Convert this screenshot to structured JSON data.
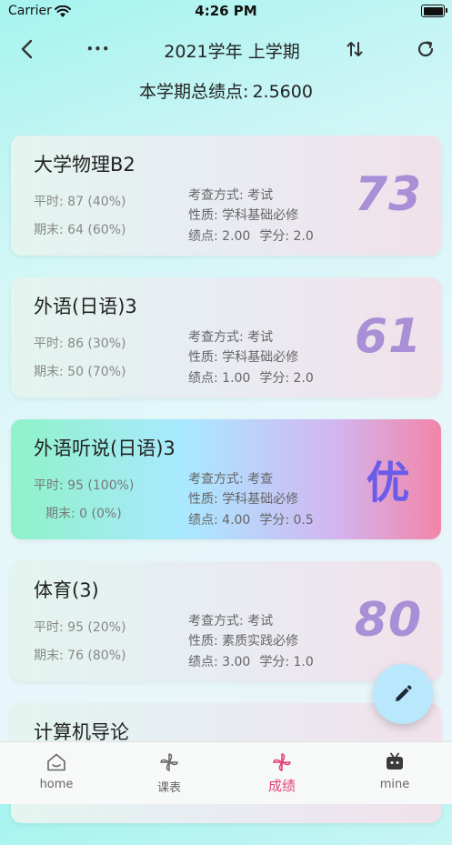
{
  "status": {
    "carrier": "Carrier",
    "time": "4:26 PM"
  },
  "nav": {
    "title": "2021学年  上学期",
    "more": "•••"
  },
  "summary": {
    "label": "本学期总绩点:",
    "value": "2.5600"
  },
  "courses": [
    {
      "name": "大学物理B2",
      "usual": "平时: 87 (40%)",
      "final": "期末: 64 (60%)",
      "method": "考查方式: 考试",
      "nature": "性质: 学科基础必修",
      "gpa": "绩点: 2.00",
      "credit": "学分: 2.0",
      "score": "73"
    },
    {
      "name": "外语(日语)3",
      "usual": "平时: 86 (30%)",
      "final": "期末: 50 (70%)",
      "method": "考查方式: 考试",
      "nature": "性质: 学科基础必修",
      "gpa": "绩点: 1.00",
      "credit": "学分: 2.0",
      "score": "61"
    },
    {
      "name": "外语听说(日语)3",
      "usual": "平时: 95 (100%)",
      "final": "期末: 0 (0%)",
      "method": "考查方式: 考查",
      "nature": "性质: 学科基础必修",
      "gpa": "绩点: 4.00",
      "credit": "学分: 0.5",
      "score": "优"
    },
    {
      "name": "体育(3)",
      "usual": "平时: 95 (20%)",
      "final": "期末: 76 (80%)",
      "method": "考查方式: 考试",
      "nature": "性质: 素质实践必修",
      "gpa": "绩点: 3.00",
      "credit": "学分: 1.0",
      "score": "80"
    },
    {
      "name": "计算机导论",
      "usual": "",
      "final": "",
      "method": "",
      "nature": "",
      "gpa": "",
      "credit": "",
      "score": ""
    }
  ],
  "tabs": [
    {
      "label": "home",
      "icon": "house-icon"
    },
    {
      "label": "课表",
      "icon": "pinwheel-icon"
    },
    {
      "label": "成绩",
      "icon": "pinwheel-icon"
    },
    {
      "label": "mine",
      "icon": "tv-icon"
    }
  ],
  "active_tab": "成绩",
  "colors": {
    "accent": "#e0407a",
    "score": "#a88fd6",
    "fab": "#b9e7fb"
  }
}
